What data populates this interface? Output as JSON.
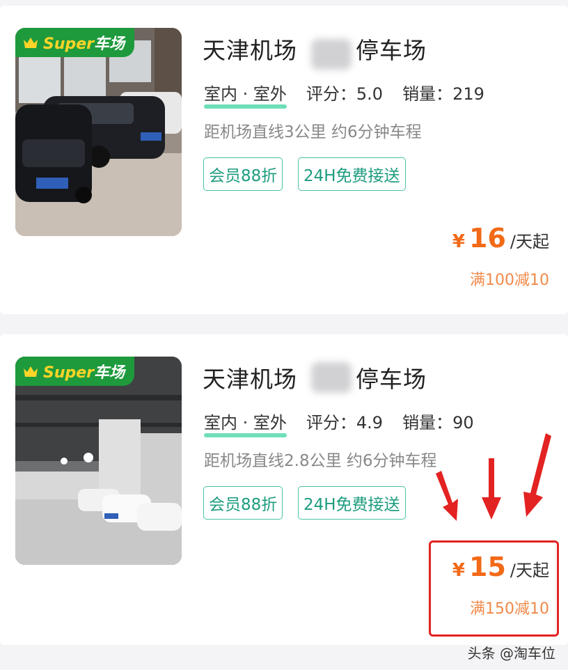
{
  "listings": [
    {
      "badge_super": "Super",
      "badge_text": "车场",
      "title_before": "天津机场",
      "title_visible_fragment": "停车场",
      "type": "室内 · 室外",
      "rating_label": "评分：",
      "rating": "5.0",
      "sales_label": "销量：",
      "sales": "219",
      "distance": "距机场直线3公里 约6分钟车程",
      "tags": [
        "会员88折",
        "24H免费接送"
      ],
      "currency": "¥",
      "price": "16",
      "price_unit": "/天起",
      "discount": "满100减10"
    },
    {
      "badge_super": "Super",
      "badge_text": "车场",
      "title_before": "天津机场",
      "title_visible_fragment": "停车场",
      "type": "室内 · 室外",
      "rating_label": "评分：",
      "rating": "4.9",
      "sales_label": "销量：",
      "sales": "90",
      "distance": "距机场直线2.8公里 约6分钟车程",
      "tags": [
        "会员88折",
        "24H免费接送"
      ],
      "currency": "¥",
      "price": "15",
      "price_unit": "/天起",
      "discount": "满150减10"
    }
  ],
  "watermark": "头条 @淘车位",
  "colors": {
    "badge_green": "#1e9a3c",
    "tag_teal": "#47c3a5",
    "price_orange": "#f26a18",
    "highlight_red": "#e32222"
  },
  "icons": {
    "badge": "crown-icon",
    "annotation": "red-arrow-icon"
  }
}
